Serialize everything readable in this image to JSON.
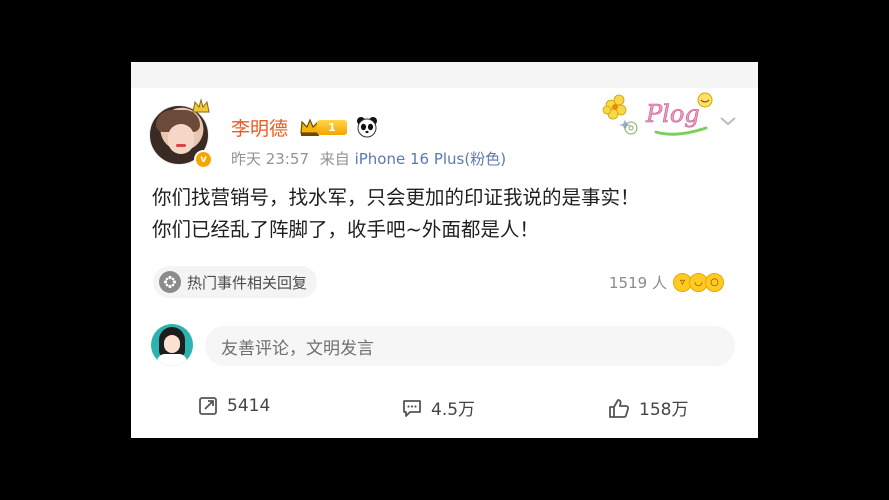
{
  "post": {
    "username": "李明德",
    "level": "1",
    "time": "昨天 23:57",
    "source_prefix": "来自",
    "source": "iPhone 16 Plus(粉色)",
    "verified_mark": "v",
    "content_lines": [
      "你们找营销号，找水军，只会更加的印证我说的是事实！",
      "你们已经乱了阵脚了，收手吧~外面都是人！"
    ],
    "hot_topic_label": "热门事件相关回复",
    "reaction_count": "1519 人",
    "comment_placeholder": "友善评论，文明发言",
    "stats": {
      "reposts": "5414",
      "comments": "4.5万",
      "likes": "158万"
    }
  },
  "colors": {
    "username": "#f05a1c",
    "meta": "#939393",
    "source": "#5c7aaf",
    "background": "#000000",
    "card": "#ffffff"
  },
  "icons": [
    "crown-icon",
    "level-badge",
    "panda-icon",
    "verified-icon",
    "plog-sticker",
    "chevron-down-icon",
    "hot-topic-icon",
    "emoji-reaction-icons",
    "repost-icon",
    "comment-icon",
    "like-icon"
  ]
}
